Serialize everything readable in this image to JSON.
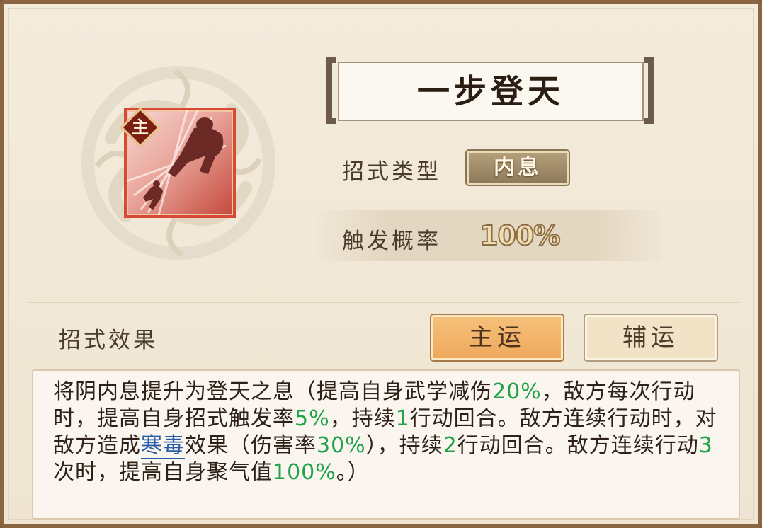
{
  "skill": {
    "name": "一步登天",
    "badge": "主",
    "type_label": "招式类型",
    "type_value": "内息",
    "rate_label": "触发概率",
    "rate_value": "100%"
  },
  "effect": {
    "label": "招式效果",
    "tabs": [
      {
        "label": "主运",
        "active": true
      },
      {
        "label": "辅运",
        "active": false
      }
    ],
    "description": [
      {
        "t": "将阴内息提升为登天之息（提高自身武学减伤"
      },
      {
        "t": "20%",
        "style": "green"
      },
      {
        "t": "，敌方每次行动时，提高自身招式触发率"
      },
      {
        "t": "5%",
        "style": "green"
      },
      {
        "t": "，持续"
      },
      {
        "t": "1",
        "style": "green"
      },
      {
        "t": "行动回合。敌方连续行动时，对敌方造成"
      },
      {
        "t": "寒毒",
        "style": "link"
      },
      {
        "t": "效果（伤害率"
      },
      {
        "t": "30%",
        "style": "green"
      },
      {
        "t": "），持续"
      },
      {
        "t": "2",
        "style": "green"
      },
      {
        "t": "行动回合。敌方连续行动"
      },
      {
        "t": "3",
        "style": "green"
      },
      {
        "t": "次时，提高自身聚气值"
      },
      {
        "t": "100%",
        "style": "green"
      },
      {
        "t": "。）"
      }
    ]
  },
  "colors": {
    "accent_green": "#22a34a",
    "link_blue": "#2a5da8",
    "active_tab": "#eda95c",
    "icon_border": "#d84a35"
  },
  "icons": [
    "cloud-emblem-icon",
    "leaping-figure-icon",
    "main-badge-icon"
  ]
}
